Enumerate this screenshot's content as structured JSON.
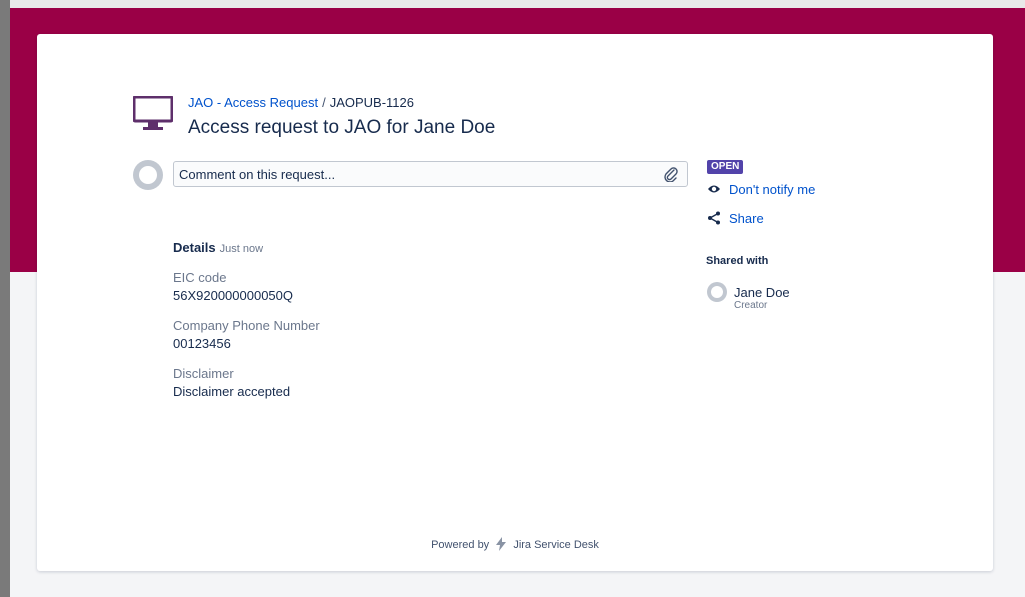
{
  "header": {
    "breadcrumb_portal": "JAO - Access Request",
    "breadcrumb_separator": "/",
    "breadcrumb_issue": "JAOPUB-1126",
    "title": "Access request to JAO for Jane Doe",
    "portal_icon": "monitor-icon"
  },
  "comment": {
    "placeholder": "Comment on this request...",
    "attach_icon": "paperclip-icon"
  },
  "details": {
    "heading": "Details",
    "timestamp": "Just now",
    "fields": [
      {
        "label": "EIC code",
        "value": "56X920000000050Q"
      },
      {
        "label": "Company Phone Number",
        "value": "00123456"
      },
      {
        "label": "Disclaimer",
        "value": "Disclaimer accepted"
      }
    ]
  },
  "sidebar": {
    "status": "OPEN",
    "notify_label": "Don't notify me",
    "notify_icon": "eye-icon",
    "share_label": "Share",
    "share_icon": "share-icon",
    "shared_with_heading": "Shared with",
    "shared_user": {
      "name": "Jane Doe",
      "role": "Creator"
    }
  },
  "footer": {
    "powered_prefix": "Powered by",
    "product": "Jira Service Desk"
  },
  "colors": {
    "banner": "#9a0046",
    "status_badge": "#5243aa",
    "link": "#0052cc"
  }
}
